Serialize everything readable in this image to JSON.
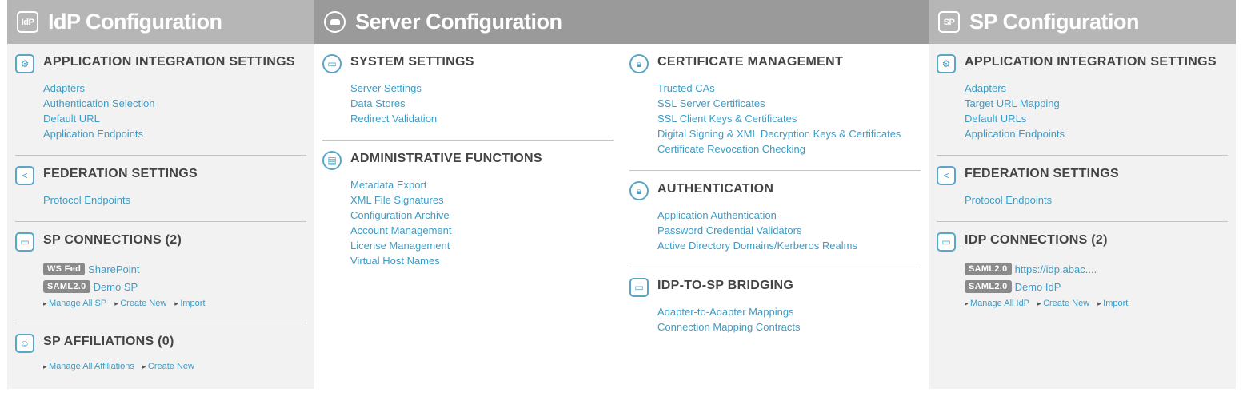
{
  "idp": {
    "title": "IdP Configuration",
    "icon_text": "IdP",
    "app_integration": {
      "title": "APPLICATION INTEGRATION SETTINGS",
      "links": [
        "Adapters",
        "Authentication Selection",
        "Default URL",
        "Application Endpoints"
      ]
    },
    "federation": {
      "title": "FEDERATION SETTINGS",
      "links": [
        "Protocol Endpoints"
      ]
    },
    "sp_connections": {
      "title": "SP CONNECTIONS (2)",
      "items": [
        {
          "badge": "WS Fed",
          "name": "SharePoint"
        },
        {
          "badge": "SAML2.0",
          "name": "Demo SP"
        }
      ],
      "actions": [
        "Manage All SP",
        "Create New",
        "Import"
      ]
    },
    "sp_affiliations": {
      "title": "SP AFFILIATIONS (0)",
      "actions": [
        "Manage All Affiliations",
        "Create New"
      ]
    }
  },
  "server": {
    "title": "Server Configuration",
    "system": {
      "title": "SYSTEM SETTINGS",
      "links": [
        "Server Settings",
        "Data Stores",
        "Redirect Validation"
      ]
    },
    "admin": {
      "title": "ADMINISTRATIVE FUNCTIONS",
      "links": [
        "Metadata Export",
        "XML File Signatures",
        "Configuration Archive",
        "Account Management",
        "License Management",
        "Virtual Host Names"
      ]
    },
    "certificates": {
      "title": "CERTIFICATE MANAGEMENT",
      "links": [
        "Trusted CAs",
        "SSL Server Certificates",
        "SSL Client Keys & Certificates",
        "Digital Signing & XML Decryption Keys & Certificates",
        "Certificate Revocation Checking"
      ]
    },
    "authentication": {
      "title": "AUTHENTICATION",
      "links": [
        "Application Authentication",
        "Password Credential Validators",
        "Active Directory Domains/Kerberos Realms"
      ]
    },
    "bridging": {
      "title": "IDP-TO-SP BRIDGING",
      "links": [
        "Adapter-to-Adapter Mappings",
        "Connection Mapping Contracts"
      ]
    }
  },
  "sp": {
    "title": "SP Configuration",
    "icon_text": "SP",
    "app_integration": {
      "title": "APPLICATION INTEGRATION SETTINGS",
      "links": [
        "Adapters",
        "Target URL Mapping",
        "Default URLs",
        "Application Endpoints"
      ]
    },
    "federation": {
      "title": "FEDERATION SETTINGS",
      "links": [
        "Protocol Endpoints"
      ]
    },
    "idp_connections": {
      "title": "IDP CONNECTIONS (2)",
      "items": [
        {
          "badge": "SAML2.0",
          "name": "https://idp.abac...."
        },
        {
          "badge": "SAML2.0",
          "name": "Demo IdP"
        }
      ],
      "actions": [
        "Manage All IdP",
        "Create New",
        "Import"
      ]
    }
  },
  "colors": {
    "link": "#3d9cc6",
    "icon": "#5aa6c7",
    "header_side": "#b6b6b6",
    "header_center": "#9a9a9a",
    "badge": "#8a8a8a"
  }
}
